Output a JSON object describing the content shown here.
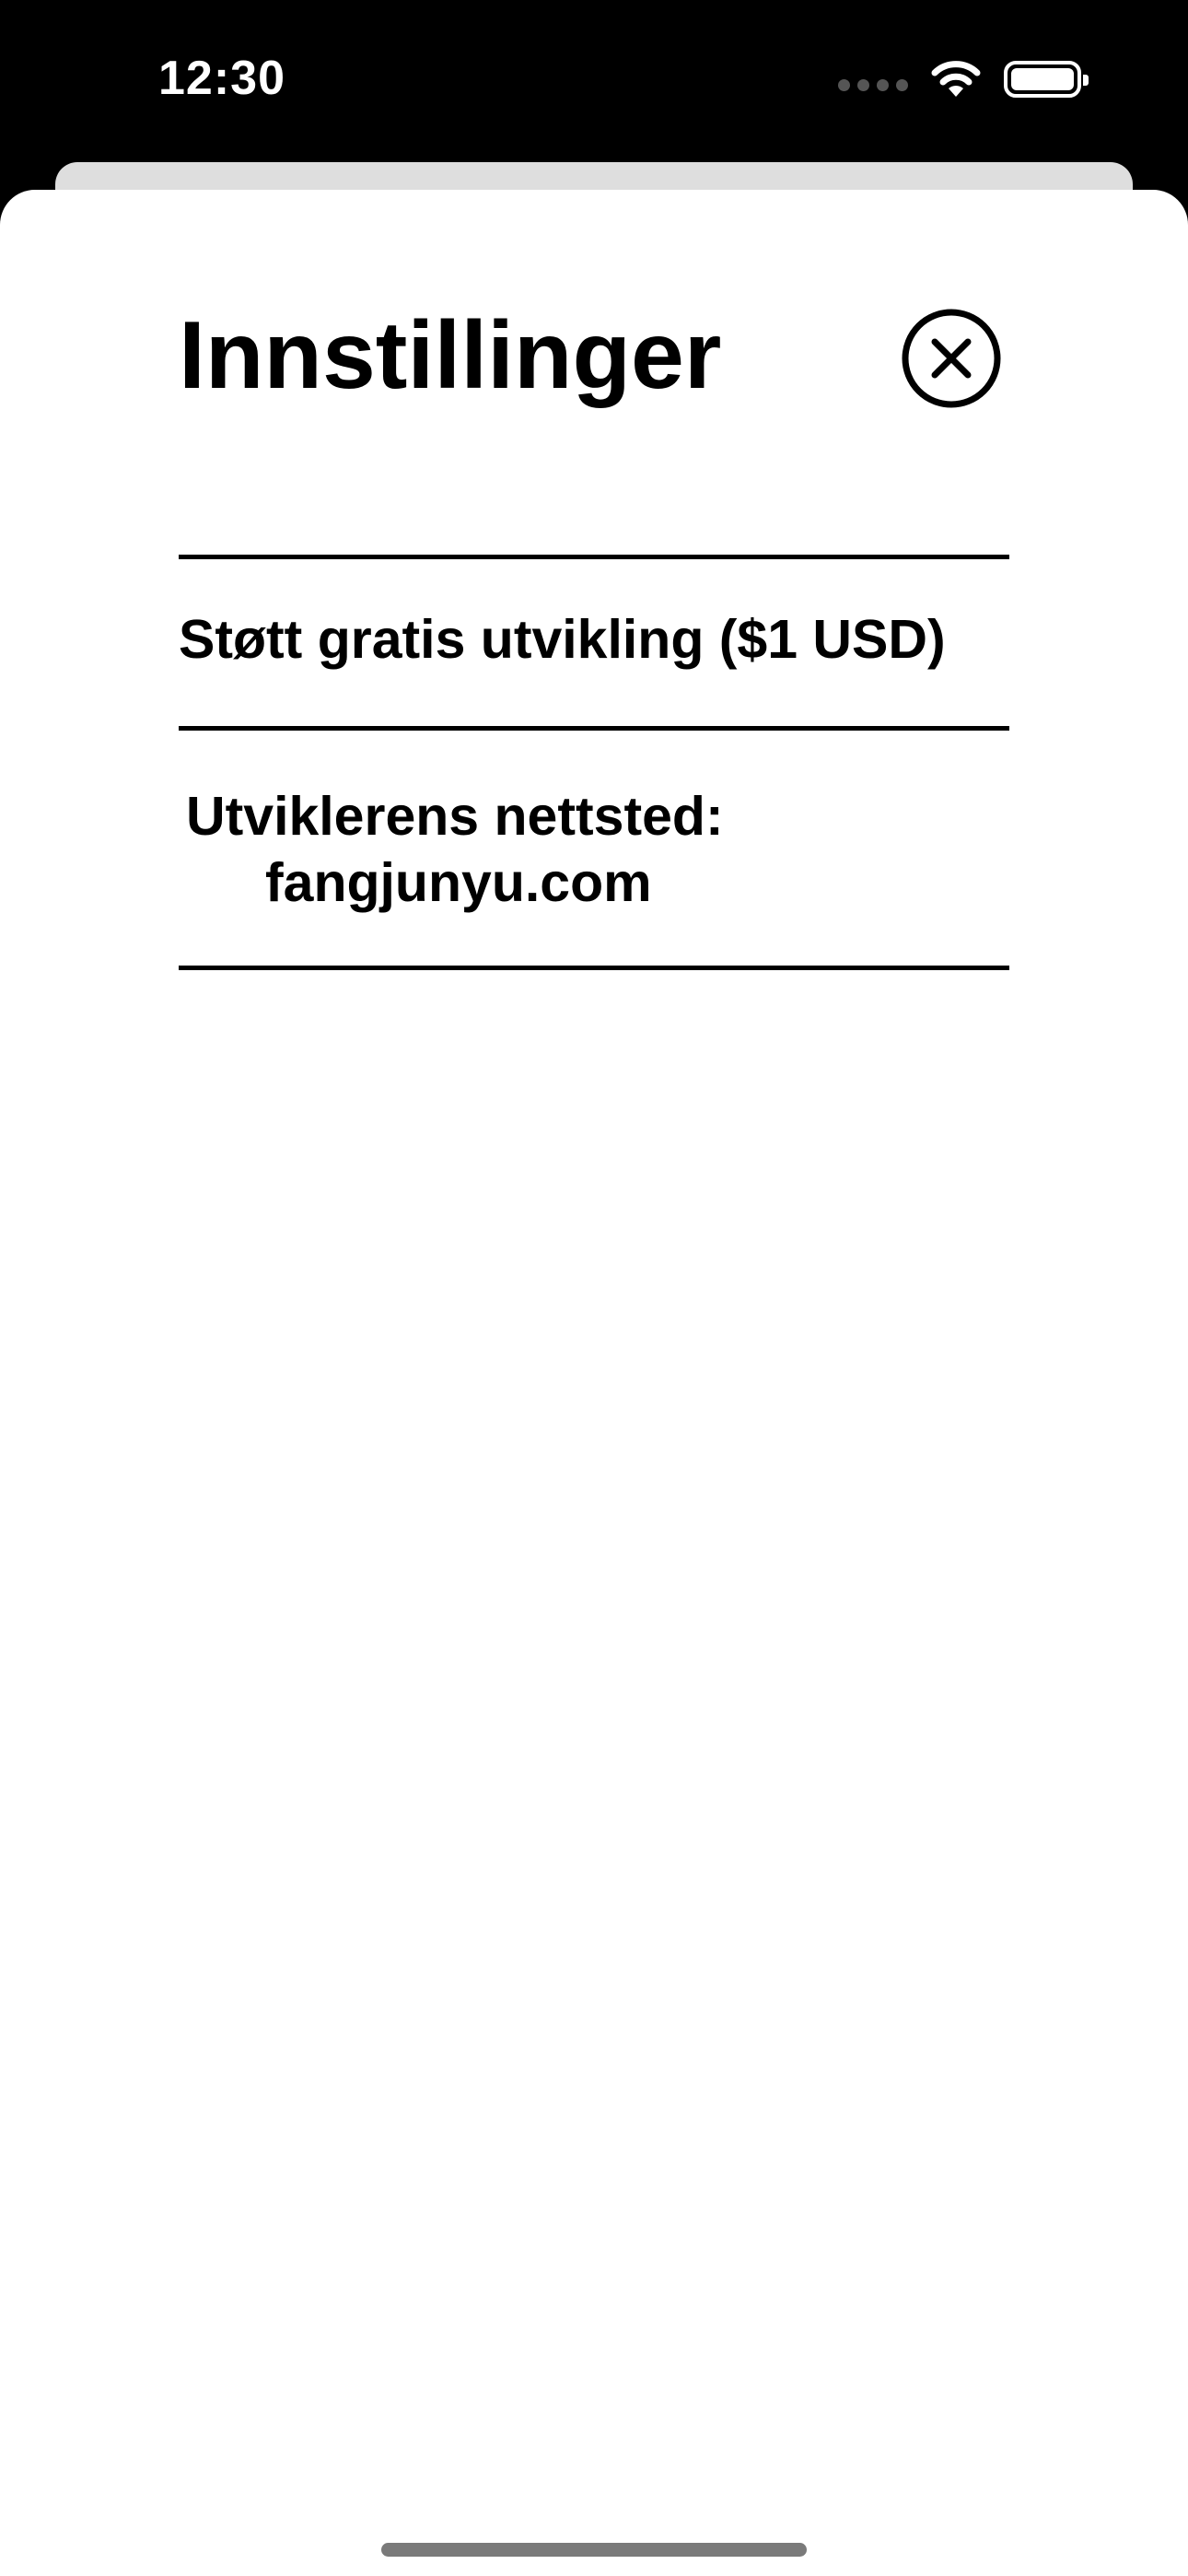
{
  "status_bar": {
    "time": "12:30",
    "icons": [
      "signal-icon",
      "wifi-icon",
      "battery-icon"
    ]
  },
  "settings_sheet": {
    "title": "Innstillinger",
    "close_icon": "close-circle-icon",
    "rows": [
      {
        "label": "Støtt gratis utvikling ($1 USD)"
      },
      {
        "label": "Utviklerens nettsted:",
        "value": "fangjunyu.com"
      }
    ]
  },
  "colors": {
    "background": "#000000",
    "sheet": "#ffffff",
    "text": "#000000",
    "back_card": "#dedede"
  }
}
